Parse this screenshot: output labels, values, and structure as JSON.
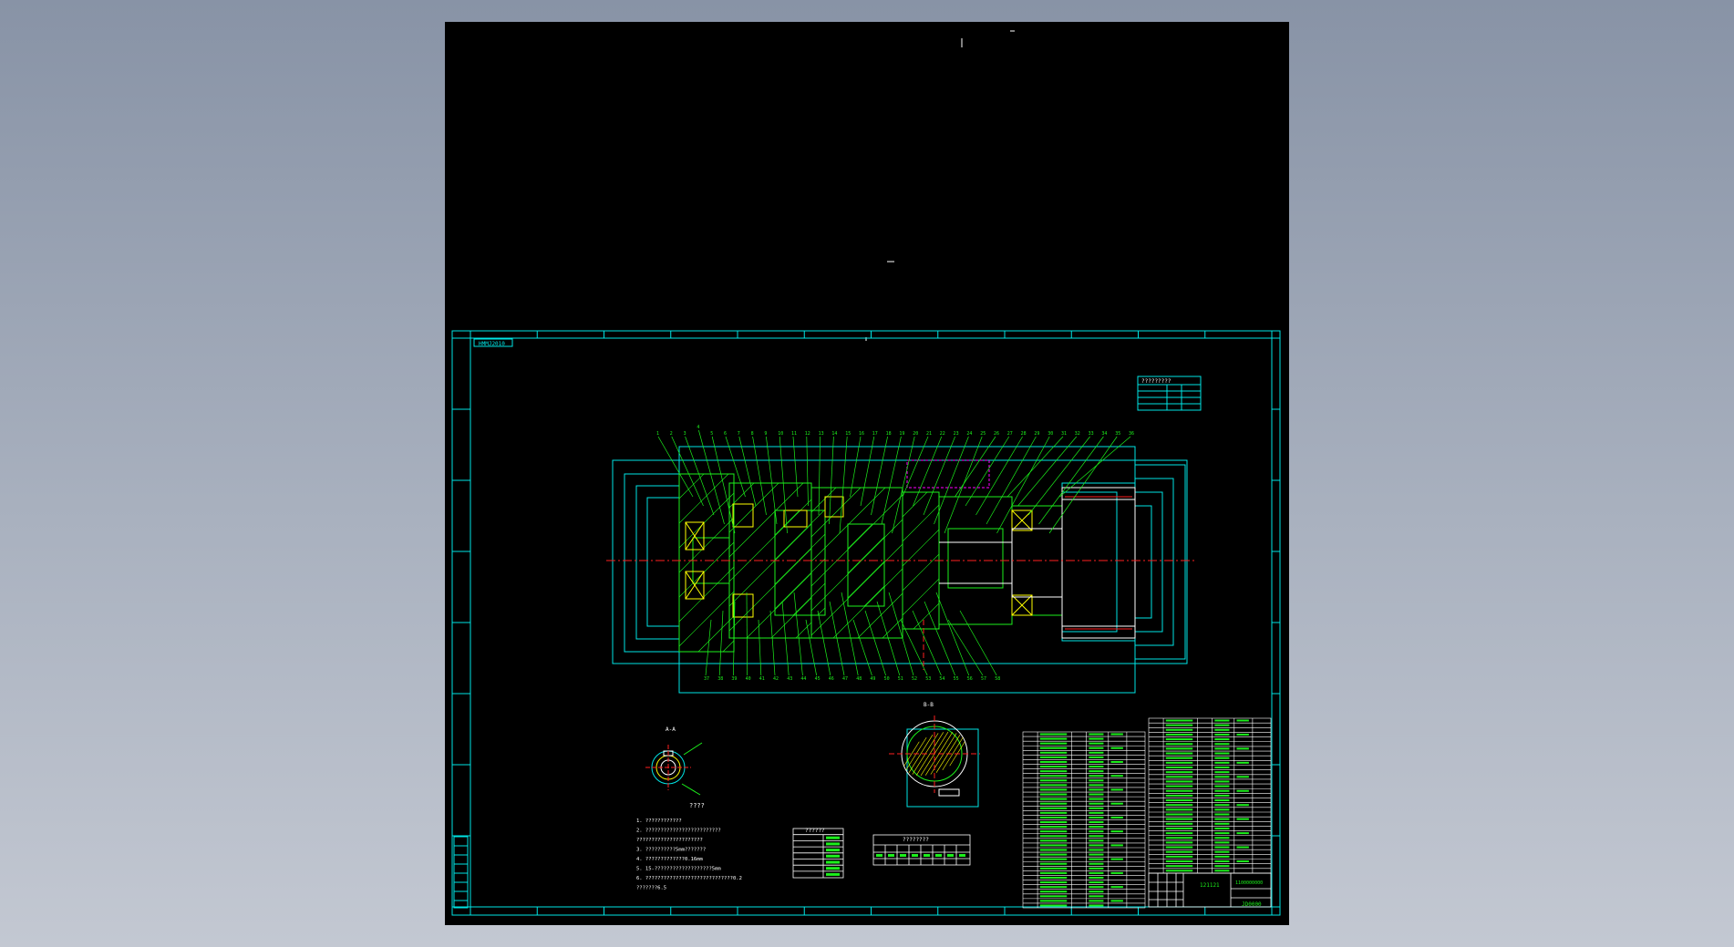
{
  "drawing": {
    "tag_label": "HMMJ2010",
    "drawing_number": "JD0000",
    "title_code": "121121",
    "code_cell": "1100000000",
    "drawing_type": "assembly-section",
    "colors": {
      "background": "#000000",
      "frame": "#00e5e5",
      "geometry": "#1cf01c",
      "yellow": "#ffff00",
      "red": "#ff2020",
      "magenta": "#ff00ff",
      "canvas": "#a9b1bf"
    }
  },
  "labels": {
    "section_a": "A-A",
    "section_b": "B-B",
    "view_title": "????"
  },
  "notes": [
    "1. ????????????",
    "2. ?????????????????????????",
    "   ??????????????????????",
    "3. ??????????5mm???????",
    "4. ?????????????0.16mm",
    "5. 15-???????????????????5mm",
    "6. ?????????????????????????????0.2",
    "   ???????6.5"
  ],
  "tables": {
    "top_right_title": "?????????",
    "tech_title": "??????",
    "tech2_title": "????????"
  },
  "balloons_top": [
    "1",
    "2",
    "3",
    "4",
    "5",
    "6",
    "7",
    "8",
    "9",
    "10",
    "11",
    "12",
    "13",
    "14",
    "15",
    "16",
    "17",
    "18",
    "19",
    "20",
    "21",
    "22",
    "23",
    "24",
    "25",
    "26",
    "27",
    "28",
    "29",
    "30",
    "31",
    "32",
    "33",
    "34",
    "35",
    "36"
  ],
  "balloons_bottom": [
    "37",
    "38",
    "39",
    "40",
    "41",
    "42",
    "43",
    "44",
    "45",
    "46",
    "47",
    "48",
    "49",
    "50",
    "51",
    "52",
    "53",
    "54",
    "55",
    "56",
    "57",
    "58"
  ]
}
